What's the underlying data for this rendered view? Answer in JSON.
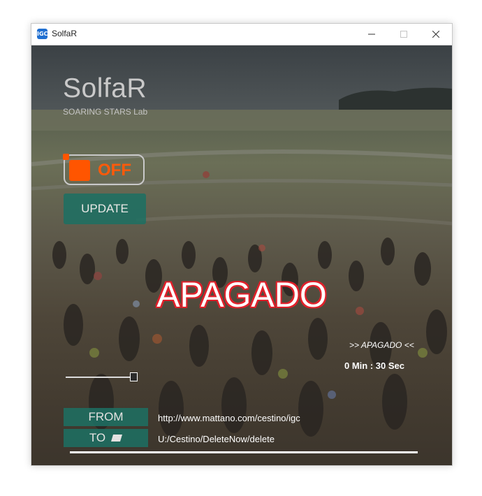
{
  "window": {
    "title": "SolfaR",
    "app_icon_text": "IGC"
  },
  "brand": {
    "name": "SolfaR",
    "subtitle": "SOARING STARS Lab"
  },
  "toggle": {
    "label": "OFF",
    "state": "off",
    "accent_color": "#ff5500"
  },
  "update_button": {
    "label": "UPDATE"
  },
  "status": {
    "big_text": "APAGADO",
    "small_text": ">> APAGADO <<",
    "timer": "0 Min  : 30 Sec"
  },
  "slider": {
    "value": 0.92
  },
  "paths": {
    "from_label": "FROM",
    "from_value": "http://www.mattano.com/cestino/igc",
    "to_label": "TO",
    "to_value": "U:/Cestino/DeleteNow/delete"
  },
  "progress": {
    "value": 1.0
  },
  "colors": {
    "button_bg": "#1d7063",
    "status_outline": "#e0202a",
    "accent": "#ff5500"
  },
  "icons": [
    "app-icon",
    "minimize-icon",
    "maximize-icon",
    "close-icon",
    "folder-icon"
  ]
}
